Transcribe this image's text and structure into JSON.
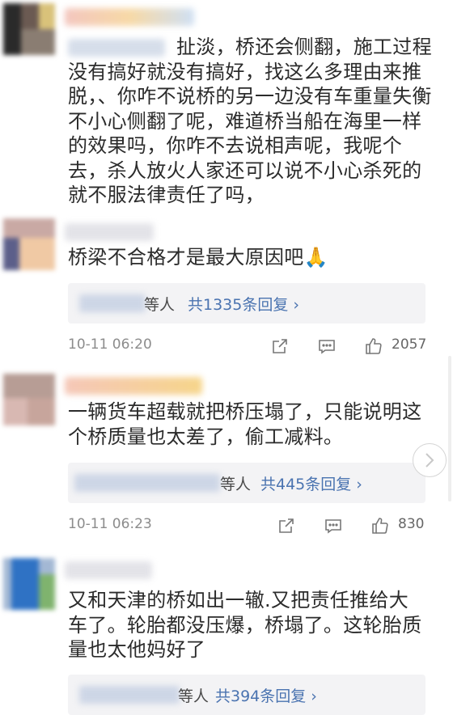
{
  "comments": [
    {
      "mention": "",
      "text": "扯淡，桥还会侧翻，施工过程没有搞好就没有搞好，找这么多理由来推脱，、你咋不说桥的另一边没有车重量失衡不小心侧翻了呢，难道桥当船在海里一样的效果吗，你咋不去说相声呢，我呢个去，杀人放火人家还可以说不小心杀死的就不服法律责任了吗，"
    },
    {
      "text": "桥梁不合格才是最大原因吧🙏",
      "reply_etc": "等人",
      "reply_link": "共1335条回复 ›",
      "time": "10-11 06:20",
      "likes": "2057"
    },
    {
      "text": "一辆货车超载就把桥压塌了，只能说明这个桥质量也太差了，偷工减料。",
      "reply_etc": "等人",
      "reply_link": "共445条回复 ›",
      "time": "10-11 06:23",
      "likes": "830"
    },
    {
      "text": "又和天津的桥如出一辙.又把责任推给大车了。轮胎都没压爆，桥塌了。这轮胎质量也太他妈好了",
      "reply_etc": "等人",
      "reply_link": "共394条回复 ›"
    }
  ],
  "icons": {
    "share": "share-icon",
    "comment": "comment-icon",
    "like": "thumbs-up-icon",
    "scroll": "chevron-right-icon"
  },
  "colors": {
    "link": "#4a73b0",
    "time": "#8c8c8c",
    "reply_bg": "#f3f3f5"
  }
}
